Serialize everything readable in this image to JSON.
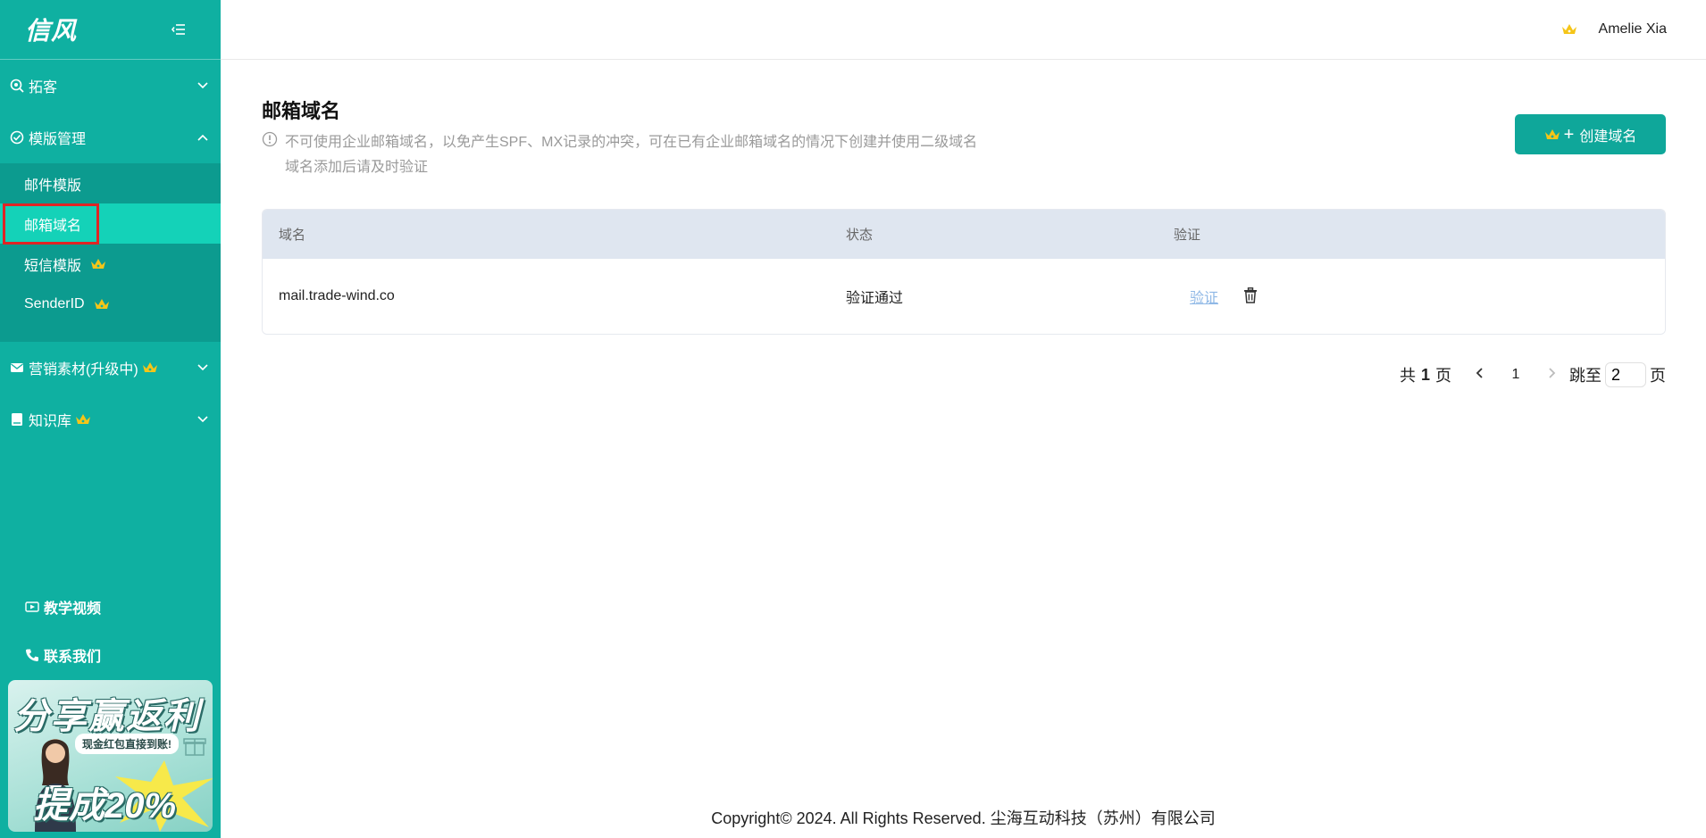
{
  "app": {
    "logo": "信风"
  },
  "sidebar": {
    "groups": [
      {
        "label": "拓客",
        "icon": "search-icon",
        "expanded": false
      },
      {
        "label": "模版管理",
        "icon": "check-circle-icon",
        "expanded": true,
        "items": [
          {
            "label": "邮件模版",
            "active": false,
            "vip": false
          },
          {
            "label": "邮箱域名",
            "active": true,
            "vip": false
          },
          {
            "label": "短信模版",
            "active": false,
            "vip": true
          },
          {
            "label": "SenderID",
            "active": false,
            "vip": true
          }
        ]
      },
      {
        "label": "营销素材(升级中)",
        "icon": "mail-icon",
        "vip": true,
        "expanded": false
      },
      {
        "label": "知识库",
        "icon": "book-icon",
        "vip": true,
        "expanded": false
      }
    ],
    "bottom_links": [
      {
        "label": "教学视频",
        "icon": "video-icon"
      },
      {
        "label": "联系我们",
        "icon": "phone-icon"
      }
    ],
    "promo": {
      "title": "分享赢返利",
      "subtitle": "现金红包直接到账!",
      "bottom": "提成20%"
    }
  },
  "header": {
    "user_name": "Amelie Xia"
  },
  "main": {
    "title": "邮箱域名",
    "notice_line1": "不可使用企业邮箱域名，以免产生SPF、MX记录的冲突，可在已有企业邮箱域名的情况下创建并使用二级域名",
    "notice_line2": "域名添加后请及时验证",
    "create_button": "创建域名",
    "table": {
      "headers": {
        "domain": "域名",
        "status": "状态",
        "verify": "验证"
      },
      "rows": [
        {
          "domain": "mail.trade-wind.co",
          "status": "验证通过",
          "verify_link": "验证"
        }
      ]
    },
    "pagination": {
      "total_prefix": "共",
      "total_pages": "1",
      "total_suffix": "页",
      "current_page": "1",
      "jump_prefix": "跳至",
      "jump_value": "2",
      "jump_suffix": "页"
    }
  },
  "footer": {
    "copyright": "Copyright© 2024. All Rights Reserved. 尘海互动科技（苏州）有限公司"
  },
  "colors": {
    "sidebar": "#0fb0a1",
    "sidebar_sub": "#0c9b8f",
    "active_item": "#14d2b8",
    "primary_button": "#0fa79a",
    "crown": "#f5c518",
    "highlight_box": "#e02424"
  }
}
